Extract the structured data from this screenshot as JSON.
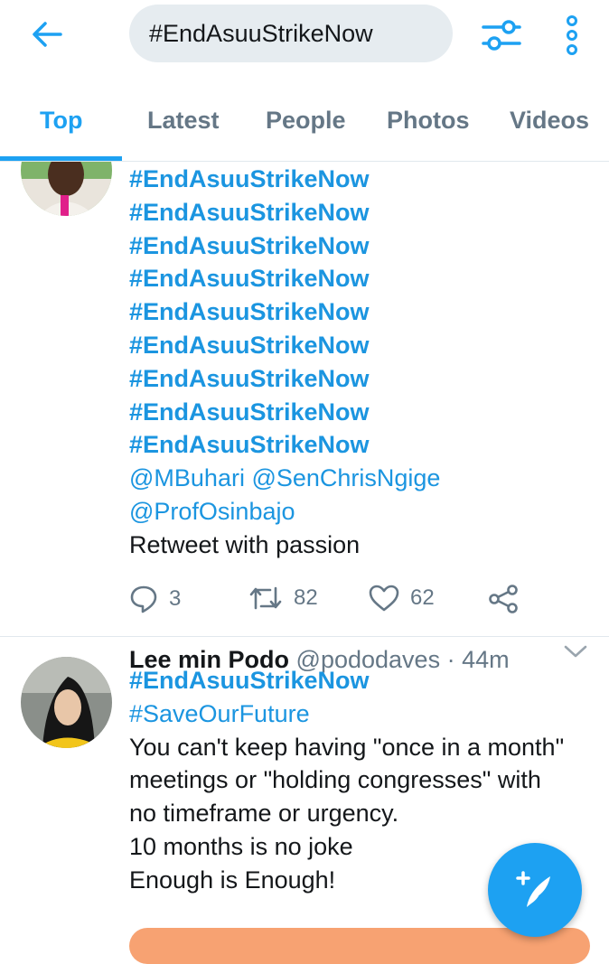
{
  "header": {
    "search_value": "#EndAsuuStrikeNow",
    "back_icon": "arrow-left-icon",
    "filter_icon": "sliders-icon",
    "more_icon": "vertical-dots-icon"
  },
  "tabs": [
    {
      "label": "Top",
      "active": true
    },
    {
      "label": "Latest",
      "active": false
    },
    {
      "label": "People",
      "active": false
    },
    {
      "label": "Photos",
      "active": false
    },
    {
      "label": "Videos",
      "active": false
    }
  ],
  "tweets": [
    {
      "lines": [
        "#EndAsuuStrikeNow",
        "#EndAsuuStrikeNow",
        "#EndAsuuStrikeNow",
        "#EndAsuuStrikeNow",
        "#EndAsuuStrikeNow",
        "#EndAsuuStrikeNow",
        "#EndAsuuStrikeNow",
        "#EndAsuuStrikeNow",
        "#EndAsuuStrikeNow",
        "@MBuhari @SenChrisNgige",
        "@ProfOsinbajo",
        "Retweet with passion"
      ],
      "reply_count": "3",
      "retweet_count": "82",
      "like_count": "62"
    },
    {
      "name": "Lee min Podo",
      "handle": "@pododaves",
      "time": "· 44m",
      "lines": [
        "#EndAsuuStrikeNow",
        "#SaveOurFuture",
        "You can't keep having \"once in a month\"",
        "meetings or \"holding congresses\" with",
        "no timeframe or urgency.",
        "10 months is no joke",
        "Enough is Enough!"
      ]
    }
  ],
  "colors": {
    "accent": "#1da1f2",
    "link": "#1b95e0",
    "muted": "#657786",
    "search_bg": "#e6ecf0",
    "promo": "#f7a272"
  },
  "fab_icon": "compose-tweet-icon"
}
